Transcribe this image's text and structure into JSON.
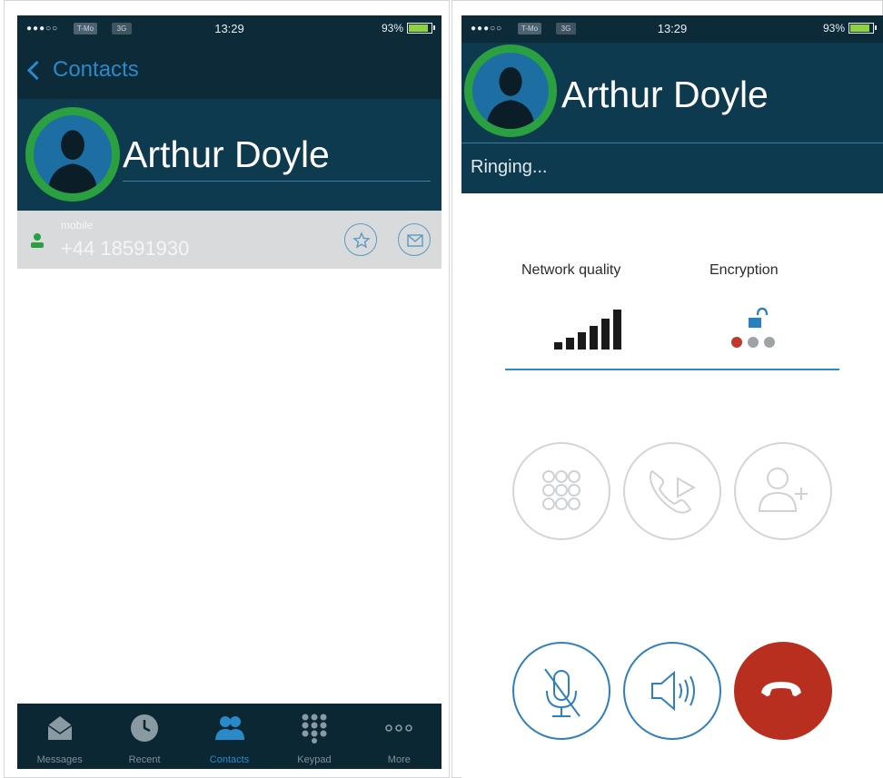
{
  "status_bar": {
    "signal": "●●●○○",
    "carrier": "T-Mo",
    "network": "3G",
    "time": "13:29",
    "battery": "93%"
  },
  "contact_screen": {
    "back_label": "Contacts",
    "contact_name": "Arthur Doyle",
    "phone_label": "mobile",
    "phone_number": "+44 18591930",
    "tabs": [
      {
        "label": "Messages",
        "icon": "envelope-icon"
      },
      {
        "label": "Recent",
        "icon": "clock-icon"
      },
      {
        "label": "Contacts",
        "icon": "contacts-icon",
        "active": true
      },
      {
        "label": "Keypad",
        "icon": "keypad-icon"
      },
      {
        "label": "More",
        "icon": "more-icon"
      }
    ]
  },
  "call_screen": {
    "contact_name": "Arthur Doyle",
    "call_status": "Ringing...",
    "network_quality_label": "Network quality",
    "encryption_label": "Encryption",
    "network_quality_bars": 6,
    "network_quality_max": 6,
    "encryption_level": 1,
    "encryption_max": 3,
    "buttons": {
      "keypad": "keypad-icon",
      "transfer": "phone-forward-icon",
      "add_participant": "add-person-icon",
      "mute": "microphone-muted-icon",
      "speaker": "speaker-icon",
      "end_call": "hang-up-icon"
    }
  },
  "colors": {
    "header": "#0e3a50",
    "status_bar": "#0d2a38",
    "avatar_ring": "#2aa040",
    "accent": "#2a89c9",
    "end_call": "#b82f1f",
    "encryption_dot_active": "#c0392b"
  }
}
